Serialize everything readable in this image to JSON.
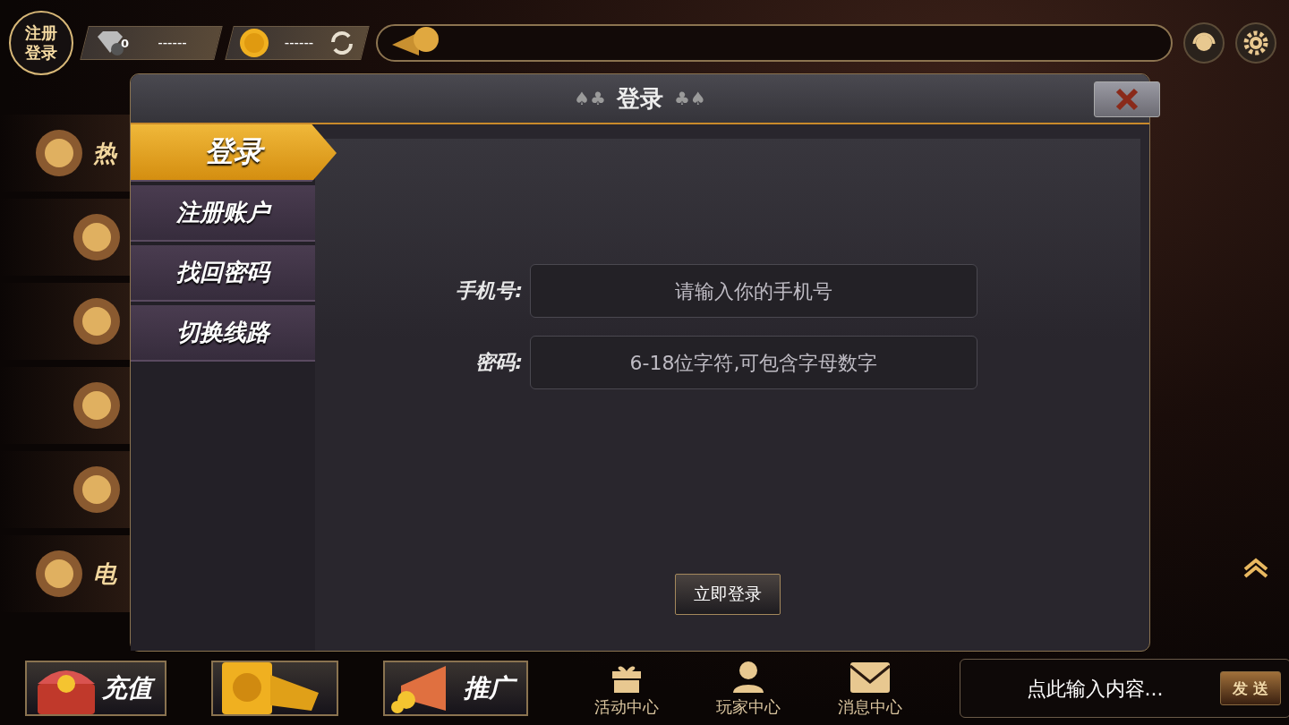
{
  "top_bar": {
    "account_badge": "注册登录",
    "diamonds": {
      "count": "0",
      "value": "------"
    },
    "coins": {
      "value": "------"
    }
  },
  "sidebar": {
    "items": [
      {
        "kind": "label",
        "label": "热"
      },
      {
        "kind": "icon"
      },
      {
        "kind": "icon"
      },
      {
        "kind": "icon"
      },
      {
        "kind": "icon"
      },
      {
        "kind": "label",
        "label": "电"
      }
    ]
  },
  "dialog": {
    "title": "登录",
    "ornament_left": "♠♣",
    "ornament_right": "♣♠",
    "tabs": [
      {
        "label": "登录",
        "selected": true
      },
      {
        "label": "注册账户",
        "selected": false
      },
      {
        "label": "找回密码",
        "selected": false
      },
      {
        "label": "切换线路",
        "selected": false
      }
    ],
    "fields": [
      {
        "label": "手机号:",
        "placeholder": "请输入你的手机号"
      },
      {
        "label": "密码:",
        "placeholder": "6-18位字符,可包含字母数字"
      }
    ],
    "submit": "立即登录"
  },
  "bottom_bar": {
    "promo_buttons": [
      {
        "kind": "chest",
        "label": "充值"
      },
      {
        "kind": "card"
      },
      {
        "kind": "horn",
        "label": "推广"
      }
    ],
    "nav": [
      {
        "kind": "gift",
        "label": "活动中心"
      },
      {
        "kind": "user",
        "label": "玩家中心"
      },
      {
        "kind": "mail",
        "label": "消息中心"
      }
    ],
    "chat": {
      "placeholder": "点此输入内容...",
      "send": "发 送"
    }
  }
}
